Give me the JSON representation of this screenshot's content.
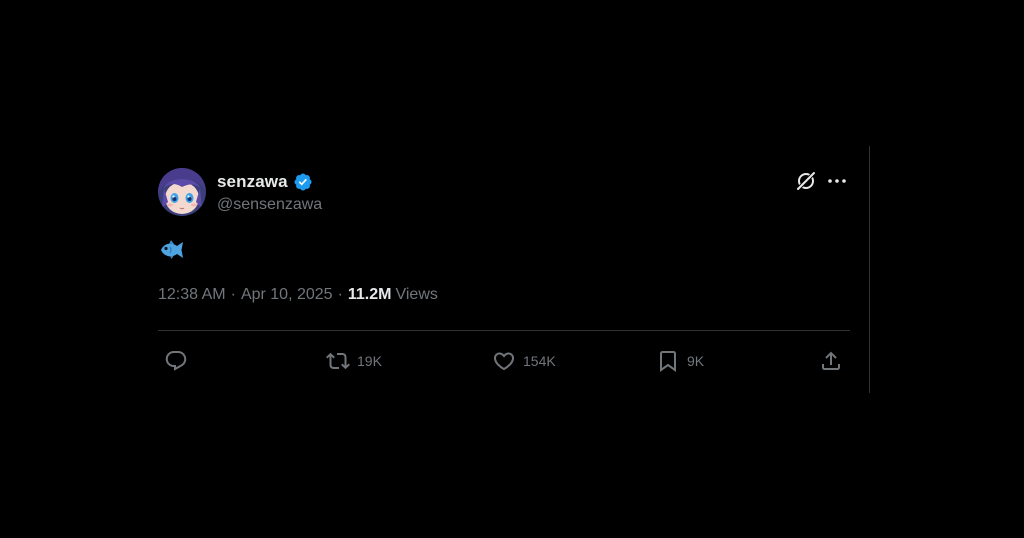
{
  "colors": {
    "background": "#000000",
    "primary_text": "#e7e9ea",
    "secondary_text": "#71767b",
    "divider": "#2f3336",
    "verified_blue": "#1d9bf0",
    "emoji_blue": "#4fa3e0"
  },
  "tweet": {
    "author": {
      "display_name": "senzawa",
      "handle": "@sensenzawa",
      "verified": true,
      "avatar_icon": "anime-avatar"
    },
    "header_icons": [
      "grok-icon",
      "more-icon"
    ],
    "text_emoji": "fish-emoji",
    "meta": {
      "time": "12:38 AM",
      "separator": "·",
      "date": "Apr 10, 2025",
      "separator2": "·",
      "views_count": "11.2M",
      "views_label": "Views"
    },
    "actions": {
      "reply": {
        "icon": "reply-icon",
        "count": ""
      },
      "retweet": {
        "icon": "retweet-icon",
        "count": "19K"
      },
      "like": {
        "icon": "heart-icon",
        "count": "154K"
      },
      "bookmark": {
        "icon": "bookmark-icon",
        "count": "9K"
      },
      "share": {
        "icon": "share-icon",
        "count": ""
      }
    }
  }
}
